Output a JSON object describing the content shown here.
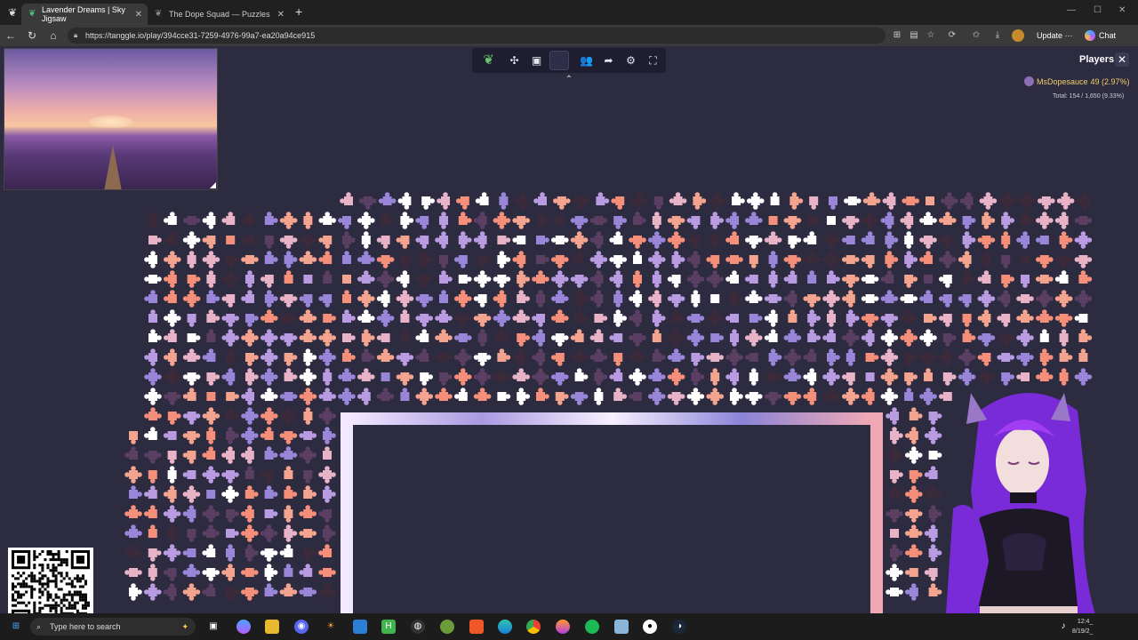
{
  "browser": {
    "tabs": [
      {
        "label": "Lavender Dreams | Sky Jigsaw",
        "active": true
      },
      {
        "label": "The Dope Squad — Puzzles",
        "active": false
      }
    ],
    "url": "https://tanggle.io/play/394cce31-7259-4976-99a7-ea20a94ce915",
    "update_label": "Update",
    "update_more": "···",
    "chat_label": "Chat"
  },
  "game": {
    "toolbar": [
      {
        "name": "leaf-logo-icon",
        "glyph": "❦"
      },
      {
        "name": "puzzle-piece-icon",
        "glyph": "✣"
      },
      {
        "name": "image-icon",
        "glyph": "▣"
      },
      {
        "name": "background-color-swatch",
        "glyph": ""
      },
      {
        "name": "players-icon",
        "glyph": "👥"
      },
      {
        "name": "share-icon",
        "glyph": "➦"
      },
      {
        "name": "settings-icon",
        "glyph": "⚙"
      },
      {
        "name": "fullscreen-icon",
        "glyph": "⛶"
      }
    ],
    "collapse_glyph": "⌃",
    "players_title": "Players",
    "players": [
      {
        "name": "MsDopesauce",
        "count": "49 (2.97%)"
      }
    ],
    "total": "Total: 154 / 1,650 (9.33%)"
  },
  "taskbar": {
    "search_placeholder": "Type here to search",
    "clock_time": "12:4_",
    "clock_date": "8/19/2_"
  },
  "colors": {
    "background": "#2c2b40",
    "piece_colors": [
      "#f4a48e",
      "#ffffff",
      "#9a86d8",
      "#e9b3c7",
      "#5a3f63",
      "#f58f7a",
      "#b89be0",
      "#3b2a3a"
    ]
  }
}
